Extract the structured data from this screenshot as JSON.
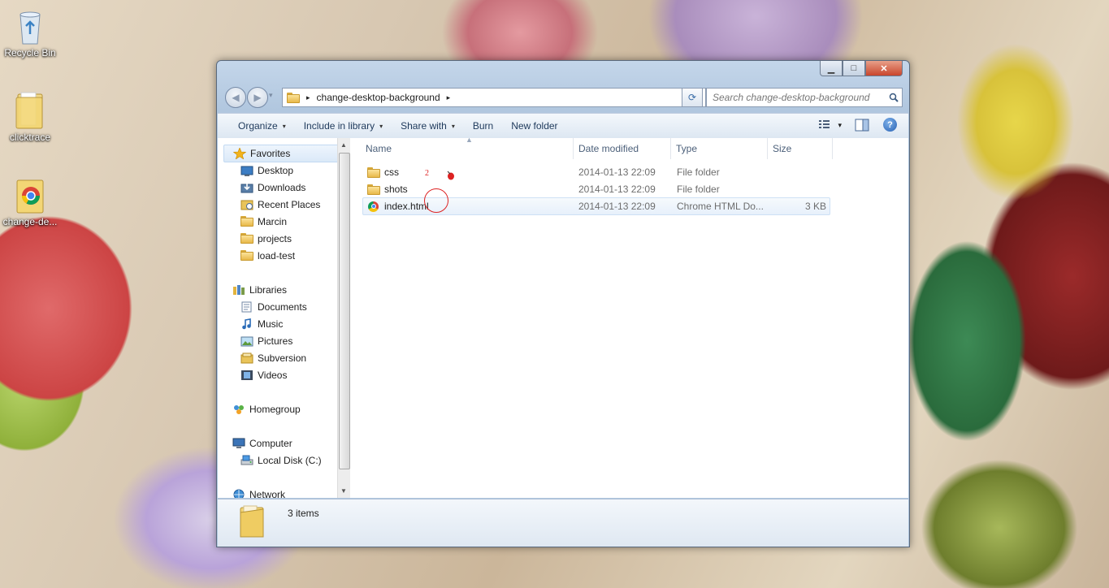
{
  "desktop": {
    "icons": [
      {
        "label": "Recycle Bin",
        "icon": "recycle-bin-icon"
      },
      {
        "label": "clicktrace",
        "icon": "folder-icon"
      },
      {
        "label": "change-de...",
        "icon": "folder-chrome-icon"
      }
    ]
  },
  "window": {
    "caption_buttons": {
      "minimize": "▁",
      "maximize": "□",
      "close": "✕"
    },
    "nav": {
      "back": "◀",
      "forward": "▶",
      "history": "▾"
    },
    "address": {
      "separator": "▸",
      "path": "change-desktop-background",
      "trail": "▸",
      "dropdown": "▾"
    },
    "refresh": "⟳",
    "search": {
      "placeholder": "Search change-desktop-background",
      "icon": "search-icon"
    },
    "toolbar": {
      "organize": "Organize",
      "include_in_library": "Include in library",
      "share_with": "Share with",
      "burn": "Burn",
      "new_folder": "New folder",
      "caret": "▾",
      "view_icon": "view-options-icon",
      "preview_icon": "preview-pane-icon",
      "help": "?"
    },
    "navpane": {
      "favorites": {
        "label": "Favorites",
        "items": [
          "Desktop",
          "Downloads",
          "Recent Places",
          "Marcin",
          "projects",
          "load-test"
        ]
      },
      "libraries": {
        "label": "Libraries",
        "items": [
          "Documents",
          "Music",
          "Pictures",
          "Subversion",
          "Videos"
        ]
      },
      "homegroup": "Homegroup",
      "computer": {
        "label": "Computer",
        "items": [
          "Local Disk (C:)"
        ]
      },
      "network": "Network"
    },
    "columns": {
      "name": "Name",
      "date": "Date modified",
      "type": "Type",
      "size": "Size",
      "sort_caret": "▲"
    },
    "files": [
      {
        "name": "css",
        "date": "2014-01-13 22:09",
        "type": "File folder",
        "size": "",
        "icon": "folder-icon"
      },
      {
        "name": "shots",
        "date": "2014-01-13 22:09",
        "type": "File folder",
        "size": "",
        "icon": "folder-icon"
      },
      {
        "name": "index.html",
        "date": "2014-01-13 22:09",
        "type": "Chrome HTML Do...",
        "size": "3 KB",
        "icon": "chrome-icon"
      }
    ],
    "click_marker": {
      "label": "2"
    },
    "details": {
      "count": "3 items"
    }
  }
}
